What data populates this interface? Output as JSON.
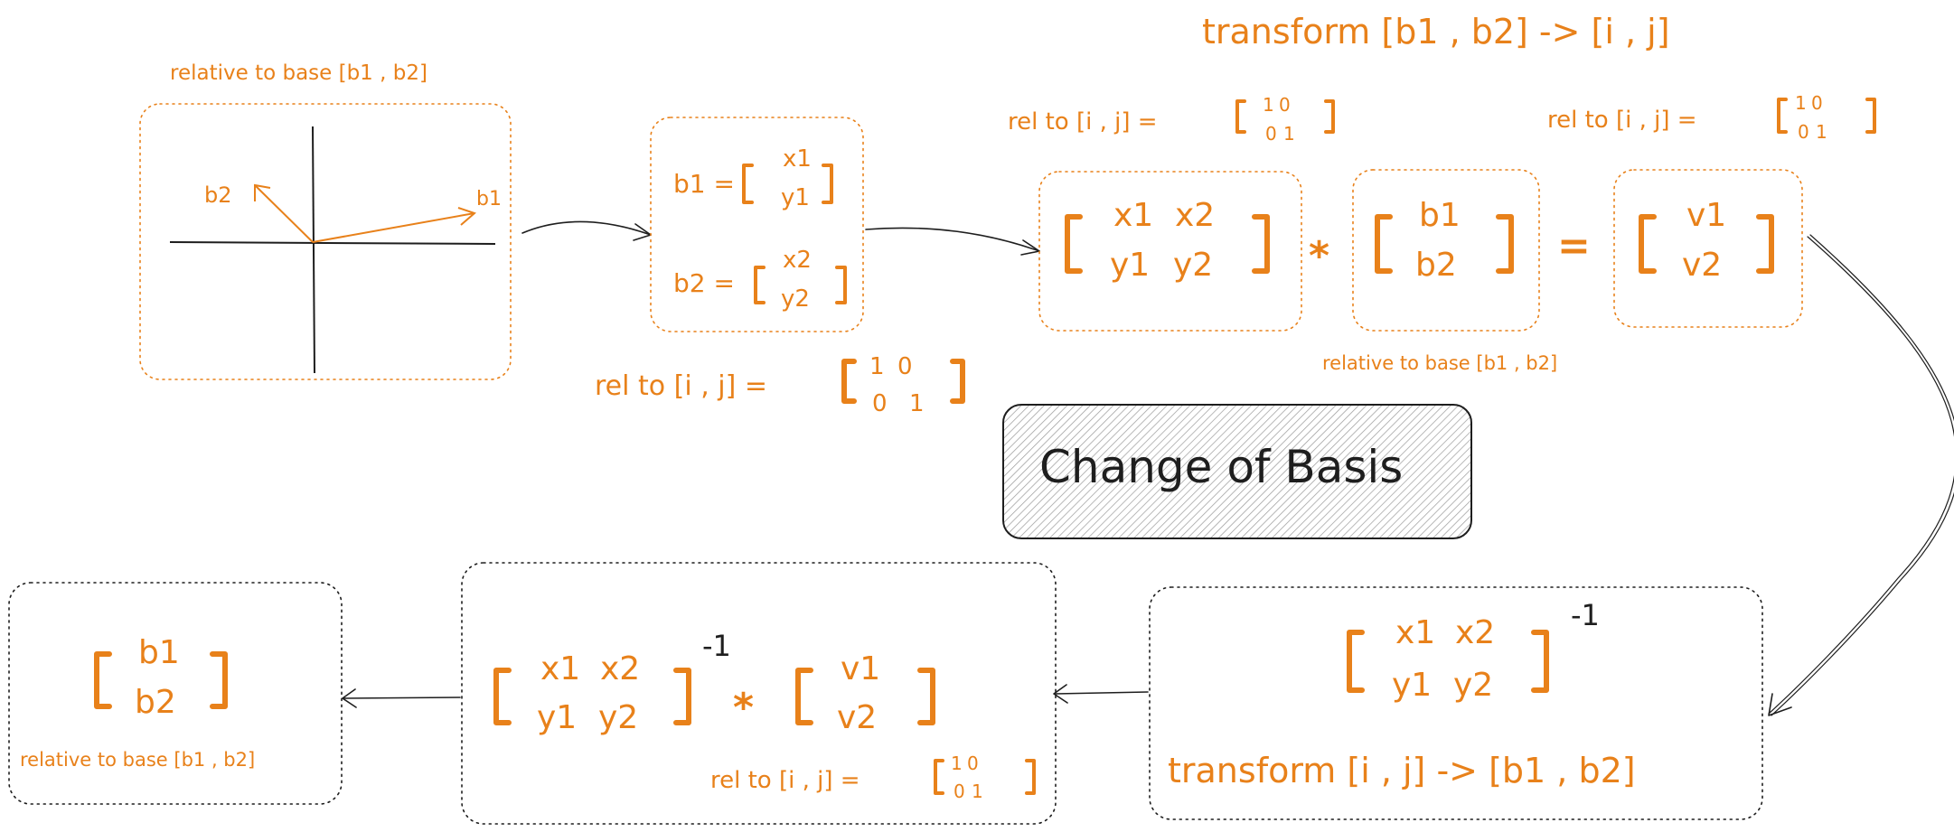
{
  "colors": {
    "accent": "#e8811a",
    "ink": "#1e1e1e",
    "hatch_fill": "#d8d8d8"
  },
  "title": "Change of Basis",
  "top_heading": "transform [b1 , b2] -> [i , j]",
  "graph": {
    "caption": "relative to base [b1 , b2]",
    "label_b1": "b1",
    "label_b2": "b2"
  },
  "vectors": {
    "b1_name": "b1 =",
    "b1_top": "x1",
    "b1_bottom": "y1",
    "b2_name": "b2 =",
    "b2_top": "x2",
    "b2_bottom": "y2",
    "rel_label": "rel to [i , j] ="
  },
  "identity": {
    "r1c1": "1",
    "r1c2": "0",
    "r2c1": "0",
    "r2c2": "1"
  },
  "matrix_eq": {
    "rel_label_left": "rel to [i , j]  =",
    "rel_label_right": "rel to [i , j]  =",
    "m_x1": "x1",
    "m_x2": "x2",
    "m_y1": "y1",
    "m_y2": "y2",
    "times": "*",
    "equals": "=",
    "b_top": "b1",
    "b_bottom": "b2",
    "b_caption": "relative to base [b1 , b2]",
    "v_top": "v1",
    "v_bottom": "v2"
  },
  "inverse": {
    "m_x1": "x1",
    "m_x2": "x2",
    "m_y1": "y1",
    "m_y2": "y2",
    "exponent": "-1",
    "caption": "transform [i , j] -> [b1 , b2]"
  },
  "solve": {
    "m_x1": "x1",
    "m_x2": "x2",
    "m_y1": "y1",
    "m_y2": "y2",
    "exponent": "-1",
    "times": "*",
    "v_top": "v1",
    "v_bottom": "v2",
    "rel_label": "rel to [i , j]  ="
  },
  "result": {
    "top": "b1",
    "bottom": "b2",
    "caption": "relative to base [b1 , b2]"
  }
}
